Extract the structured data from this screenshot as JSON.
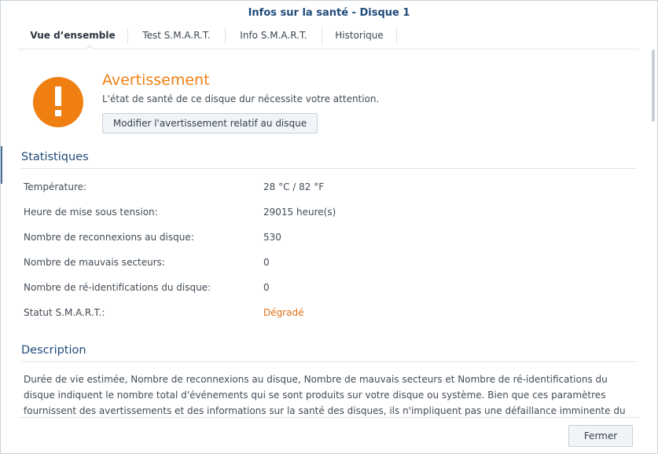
{
  "window": {
    "title": "Infos sur la santé - Disque 1"
  },
  "tabs": [
    {
      "label": "Vue d’ensemble",
      "active": true
    },
    {
      "label": "Test S.M.A.R.T.",
      "active": false
    },
    {
      "label": "Info S.M.A.R.T.",
      "active": false
    },
    {
      "label": "Historique",
      "active": false
    }
  ],
  "warning": {
    "icon": "exclamation-icon",
    "color": "#f07f12",
    "title": "Avertissement",
    "message": "L'état de santé de ce disque dur nécessite votre attention.",
    "button_label": "Modifier l'avertissement relatif au disque"
  },
  "statistics": {
    "title": "Statistiques",
    "rows": [
      {
        "label": "Température:",
        "value": "28 °C / 82 °F"
      },
      {
        "label": "Heure de mise sous tension:",
        "value": "29015 heure(s)"
      },
      {
        "label": "Nombre de reconnexions au disque:",
        "value": "530"
      },
      {
        "label": "Nombre de mauvais secteurs:",
        "value": "0"
      },
      {
        "label": "Nombre de ré-identifications du disque:",
        "value": "0"
      },
      {
        "label": "Statut S.M.A.R.T.:",
        "value": "Dégradé",
        "status_color": "#e07016"
      }
    ]
  },
  "description": {
    "title": "Description",
    "text": "Durée de vie estimée, Nombre de reconnexions au disque, Nombre de mauvais secteurs et Nombre de ré-identifications du disque indiquent le nombre total d'événements qui se sont produits sur votre disque ou système. Bien que ces paramètres fournissent des avertissements et des informations sur la santé des disques, ils n'impliquent pas une défaillance imminente du"
  },
  "footer": {
    "close_label": "Fermer"
  }
}
